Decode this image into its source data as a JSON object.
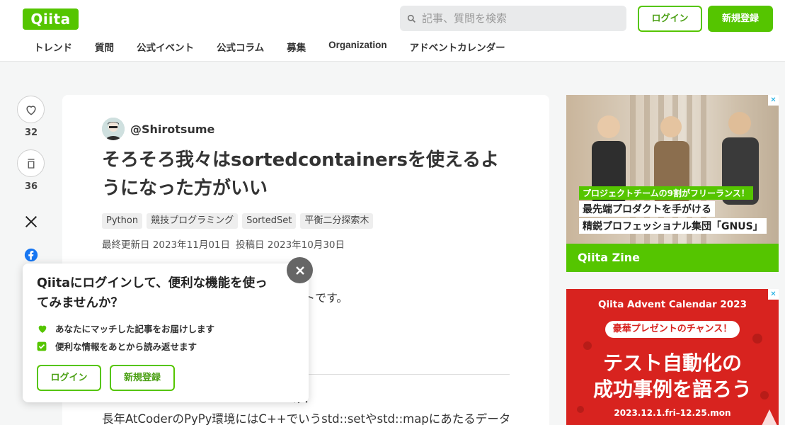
{
  "header": {
    "logo_text": "Qiita",
    "search_placeholder": "記事、質問を検索",
    "login_label": "ログイン",
    "signup_label": "新規登録",
    "nav": [
      "トレンド",
      "質問",
      "公式イベント",
      "公式コラム",
      "募集",
      "Organization",
      "アドベントカレンダー"
    ]
  },
  "rail": {
    "like_count": "32",
    "stock_count": "36"
  },
  "article": {
    "author": "@Shirotsume",
    "title": "そろそろ我々はsortedcontainersを使えるようになった方がいい",
    "tags": [
      "Python",
      "競技プログラミング",
      "SortedSet",
      "平衡二分探索木"
    ],
    "updated": "最終更新日 2023年11月01日",
    "posted": "投稿日 2023年10月30日",
    "body_fragment_1": "ートです。",
    "body_fragment_2": "け：",
    "body_line": "長年AtCoderのPyPy環境にはC++でいうstd::setやstd::mapにあたるデータ"
  },
  "popup": {
    "title": "Qiitaにログインして、便利な機能を使ってみませんか？",
    "benefits": [
      "あなたにマッチした記事をお届けします",
      "便利な情報をあとから読み返せます"
    ],
    "login_label": "ログイン",
    "signup_label": "新規登録"
  },
  "ad1": {
    "caption_1": "プロジェクトチームの9割がフリーランス！",
    "caption_2": "最先端プロダクトを手がける",
    "caption_3": "精鋭プロフェッショナル集団「GNUS」",
    "footer": "Qiita Zine"
  },
  "ad2": {
    "head": "Qiita Advent Calendar 2023",
    "pill": "豪華プレゼントのチャンス！",
    "line_1": "テスト自動化の",
    "line_2": "成功事例を語ろう",
    "date": "2023.12.1.fri–12.25.mon"
  },
  "colors": {
    "brand": "#55c500",
    "ad_red": "#d8231f"
  }
}
